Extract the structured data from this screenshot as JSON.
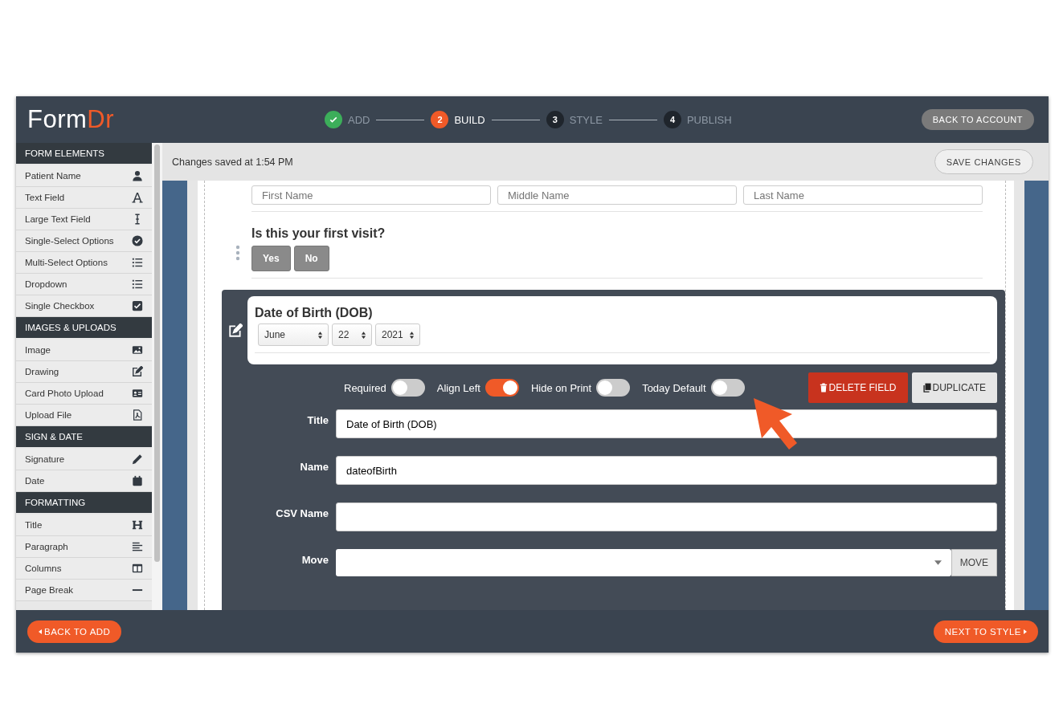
{
  "header": {
    "logo": {
      "first": "Form",
      "second": "Dr"
    },
    "steps": [
      {
        "label": "ADD",
        "completed": true,
        "selected": false
      },
      {
        "number": "2",
        "label": "BUILD",
        "completed": false,
        "selected": true
      },
      {
        "number": "3",
        "label": "STYLE",
        "completed": false,
        "selected": false
      },
      {
        "number": "4",
        "label": "PUBLISH",
        "completed": false,
        "selected": false
      }
    ],
    "account_button": "BACK TO ACCOUNT"
  },
  "sidebar": {
    "sections": [
      {
        "title": "FORM ELEMENTS",
        "items": [
          {
            "label": "Patient Name"
          },
          {
            "label": "Text Field"
          },
          {
            "label": "Large Text Field"
          },
          {
            "label": "Single-Select Options"
          },
          {
            "label": "Multi-Select Options"
          },
          {
            "label": "Dropdown"
          },
          {
            "label": "Single Checkbox"
          }
        ]
      },
      {
        "title": "IMAGES & UPLOADS",
        "items": [
          {
            "label": "Image"
          },
          {
            "label": "Drawing"
          },
          {
            "label": "Card Photo Upload"
          },
          {
            "label": "Upload File"
          }
        ]
      },
      {
        "title": "SIGN & DATE",
        "items": [
          {
            "label": "Signature"
          },
          {
            "label": "Date"
          }
        ]
      },
      {
        "title": "FORMATTING",
        "items": [
          {
            "label": "Title"
          },
          {
            "label": "Paragraph"
          },
          {
            "label": "Columns"
          },
          {
            "label": "Page Break"
          }
        ]
      }
    ]
  },
  "toolbar": {
    "status": "Changes saved at 1:54 PM",
    "save_button": "SAVE CHANGES"
  },
  "form": {
    "name_fields": [
      {
        "placeholder": "First Name"
      },
      {
        "placeholder": "Middle Name"
      },
      {
        "placeholder": "Last Name"
      }
    ],
    "question": {
      "label": "Is this your first visit?",
      "options": [
        {
          "label": "Yes",
          "selected": false
        },
        {
          "label": "No",
          "selected": false
        }
      ]
    },
    "editor": {
      "preview_title": "Date of Birth (DOB)",
      "date_selects": [
        {
          "value": "June"
        },
        {
          "value": "22"
        },
        {
          "value": "2021"
        }
      ],
      "toggles": [
        {
          "label": "Required",
          "on": false
        },
        {
          "label": "Align Left",
          "on": true
        },
        {
          "label": "Hide on Print",
          "on": false
        },
        {
          "label": "Today Default",
          "on": false
        }
      ],
      "delete_button": "DELETE FIELD",
      "duplicate_button": "DUPLICATE",
      "fields": [
        {
          "label": "Title",
          "value": "Date of Birth (DOB)",
          "kind": "text"
        },
        {
          "label": "Name",
          "value": "dateofBirth",
          "kind": "text"
        },
        {
          "label": "CSV Name",
          "kind": "text"
        },
        {
          "label": "Move",
          "kind": "select",
          "button": "MOVE"
        }
      ]
    }
  },
  "footer": {
    "back_button": "BACK TO ADD",
    "next_button": "NEXT TO STYLE"
  }
}
